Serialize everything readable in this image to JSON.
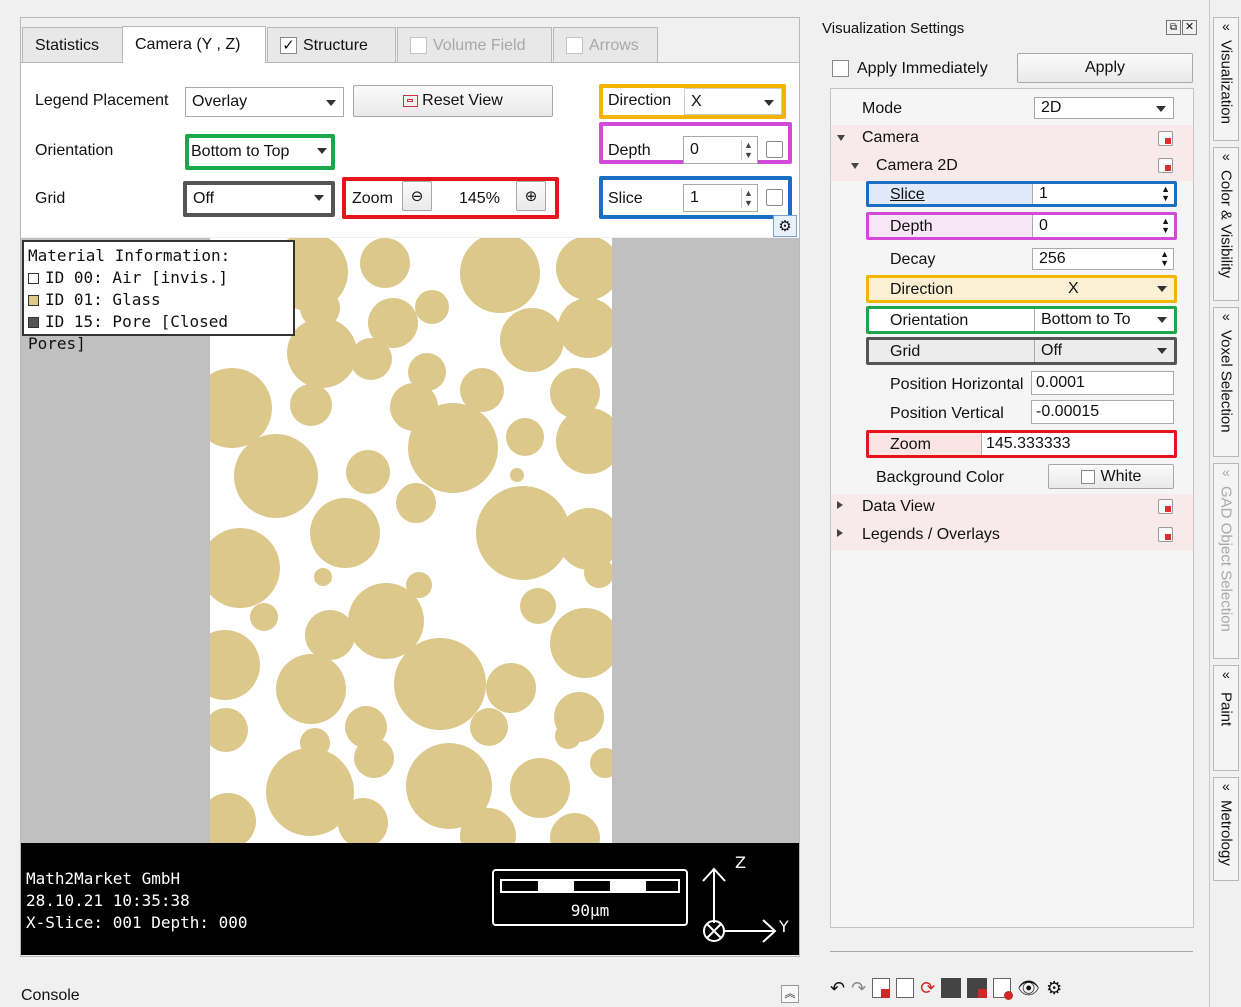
{
  "tabs": [
    {
      "label": "Statistics",
      "state": "normal"
    },
    {
      "label": "Camera (Y , Z)",
      "state": "active"
    },
    {
      "label": "Structure",
      "state": "checked",
      "checked": true
    },
    {
      "label": "Volume Field",
      "state": "disabled",
      "checked": false
    },
    {
      "label": "Arrows",
      "state": "disabled",
      "checked": false
    }
  ],
  "controls": {
    "legend_placement_label": "Legend Placement",
    "legend_placement_value": "Overlay",
    "reset_view_label": "Reset View",
    "direction_label": "Direction",
    "direction_value": "X",
    "orientation_label": "Orientation",
    "orientation_value": "Bottom to Top",
    "depth_label": "Depth",
    "depth_value": "0",
    "grid_label": "Grid",
    "grid_value": "Off",
    "zoom_label": "Zoom",
    "zoom_value": "145%",
    "slice_label": "Slice",
    "slice_value": "1"
  },
  "legend": {
    "title": "Material Information:",
    "items": [
      {
        "text": "ID 00: Air [invis.]",
        "color": "#ffffff"
      },
      {
        "text": "ID 01: Glass",
        "color": "#dcc88a"
      },
      {
        "text": "ID 15: Pore [Closed Pores]",
        "color": "#555555"
      }
    ]
  },
  "overlay": {
    "company": "Math2Market GmbH",
    "datetime": "28.10.21 10:35:38",
    "slice_info": "X-Slice: 001 Depth: 000",
    "scale_label": "90µm",
    "axis_z": "Z",
    "axis_y": "Y"
  },
  "console_label": "Console",
  "settings": {
    "title": "Visualization Settings",
    "apply_immediately_label": "Apply Immediately",
    "apply_label": "Apply",
    "mode_label": "Mode",
    "mode_value": "2D",
    "camera_label": "Camera",
    "camera2d_label": "Camera 2D",
    "slice_label": "Slice",
    "slice_value": "1",
    "depth_label": "Depth",
    "depth_value": "0",
    "decay_label": "Decay",
    "decay_value": "256",
    "direction_label": "Direction",
    "direction_value": "X",
    "orientation_label": "Orientation",
    "orientation_value": "Bottom to To",
    "grid_label": "Grid",
    "grid_value": "Off",
    "pos_h_label": "Position Horizontal",
    "pos_h_value": "0.0001",
    "pos_v_label": "Position Vertical",
    "pos_v_value": "-0.00015",
    "zoom_label": "Zoom",
    "zoom_value": "145.333333",
    "bg_color_label": "Background Color",
    "bg_color_value": "White",
    "data_view_label": "Data View",
    "legends_label": "Legends / Overlays"
  },
  "side_tabs": [
    {
      "label": "Visualization",
      "enabled": true
    },
    {
      "label": "Color & Visibility",
      "enabled": true
    },
    {
      "label": "Voxel Selection",
      "enabled": true
    },
    {
      "label": "GAD Object Selection",
      "enabled": false
    },
    {
      "label": "Paint",
      "enabled": true
    },
    {
      "label": "Metrology",
      "enabled": true
    }
  ],
  "colors": {
    "highlight_yellow": "#f5b400",
    "highlight_magenta": "#d24ad8",
    "highlight_green": "#1aa84a",
    "highlight_gray": "#555555",
    "highlight_red": "#e8141c",
    "highlight_blue": "#1a6fc4",
    "glass": "#dcc88a"
  }
}
